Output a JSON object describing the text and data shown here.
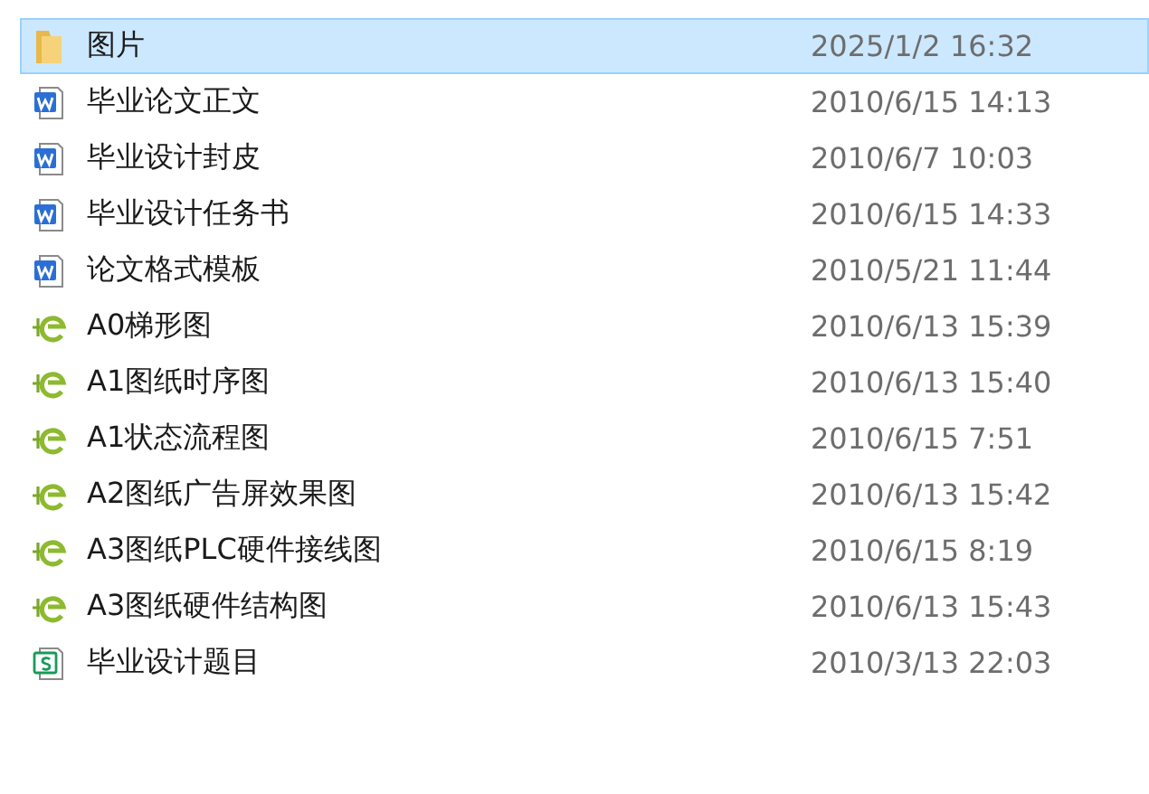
{
  "files": [
    {
      "kind": "folder",
      "name": "图片",
      "modified": "2025/1/2 16:32",
      "selected": true
    },
    {
      "kind": "word",
      "name": "毕业论文正文",
      "modified": "2010/6/15 14:13",
      "selected": false
    },
    {
      "kind": "word",
      "name": "毕业设计封皮",
      "modified": "2010/6/7 10:03",
      "selected": false
    },
    {
      "kind": "word",
      "name": "毕业设计任务书",
      "modified": "2010/6/15 14:33",
      "selected": false
    },
    {
      "kind": "word",
      "name": "论文格式模板",
      "modified": "2010/5/21 11:44",
      "selected": false
    },
    {
      "kind": "ladder",
      "name": "A0梯形图",
      "modified": "2010/6/13 15:39",
      "selected": false
    },
    {
      "kind": "ladder",
      "name": "A1图纸时序图",
      "modified": "2010/6/13 15:40",
      "selected": false
    },
    {
      "kind": "ladder",
      "name": "A1状态流程图",
      "modified": "2010/6/15 7:51",
      "selected": false
    },
    {
      "kind": "ladder",
      "name": "A2图纸广告屏效果图",
      "modified": "2010/6/13 15:42",
      "selected": false
    },
    {
      "kind": "ladder",
      "name": "A3图纸PLC硬件接线图",
      "modified": "2010/6/15 8:19",
      "selected": false
    },
    {
      "kind": "ladder",
      "name": "A3图纸硬件结构图",
      "modified": "2010/6/13 15:43",
      "selected": false
    },
    {
      "kind": "sheet",
      "name": "毕业设计题目",
      "modified": "2010/3/13 22:03",
      "selected": false
    }
  ]
}
